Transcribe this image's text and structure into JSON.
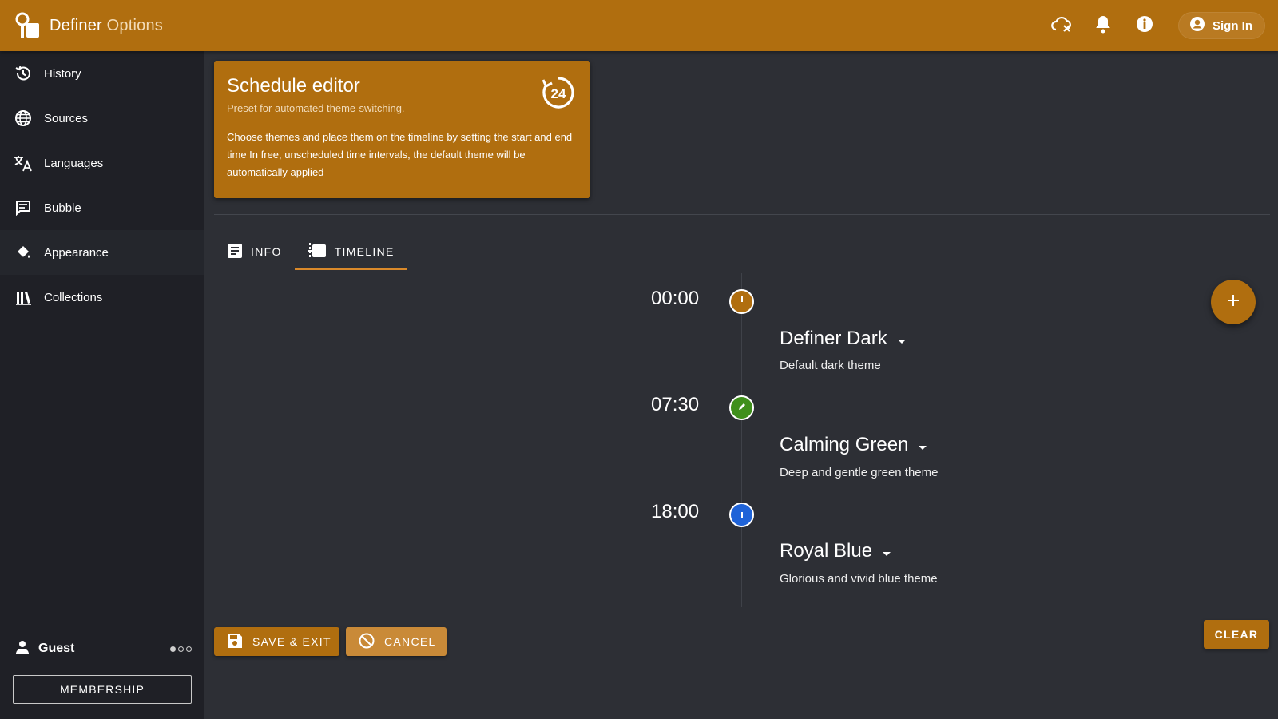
{
  "appbar": {
    "title_main": "Definer",
    "title_sub": "Options",
    "sign_in_label": "Sign In",
    "icons": [
      "cloud-off-icon",
      "bell-icon",
      "info-icon",
      "account-circle-icon"
    ]
  },
  "sidebar": {
    "items": [
      {
        "label": "History",
        "icon": "history-icon"
      },
      {
        "label": "Sources",
        "icon": "globe-icon"
      },
      {
        "label": "Languages",
        "icon": "translate-icon"
      },
      {
        "label": "Bubble",
        "icon": "chat-bubble-icon"
      },
      {
        "label": "Appearance",
        "icon": "paint-bucket-icon"
      },
      {
        "label": "Collections",
        "icon": "library-icon"
      }
    ],
    "active_item": "Appearance",
    "user_name": "Guest",
    "membership_label": "MEMBERSHIP"
  },
  "card": {
    "title": "Schedule editor",
    "subtitle": "Preset for automated theme-switching.",
    "description": "Choose themes and place them on the timeline by setting the start and end time In free, unscheduled time intervals, the default theme will be automatically applied",
    "badge_text": "24"
  },
  "tabs": [
    {
      "label": "INFO",
      "icon": "document-icon"
    },
    {
      "label": "TIMELINE",
      "icon": "timeline-icon"
    }
  ],
  "active_tab": "TIMELINE",
  "timeline": [
    {
      "time": "00:00",
      "theme": "Definer Dark",
      "description": "Default dark theme",
      "color": "#b06e0f"
    },
    {
      "time": "07:30",
      "theme": "Calming Green",
      "description": "Deep and gentle green theme",
      "color": "#3f8f1c"
    },
    {
      "time": "18:00",
      "theme": "Royal Blue",
      "description": "Glorious and vivid blue theme",
      "color": "#1f63d8"
    }
  ],
  "actions": {
    "save_label": "SAVE & EXIT",
    "cancel_label": "CANCEL",
    "clear_label": "CLEAR",
    "add_icon": "plus-icon"
  },
  "colors": {
    "accent": "#b06e0f",
    "background": "#2d2f35",
    "sidebar": "#1f2026"
  }
}
